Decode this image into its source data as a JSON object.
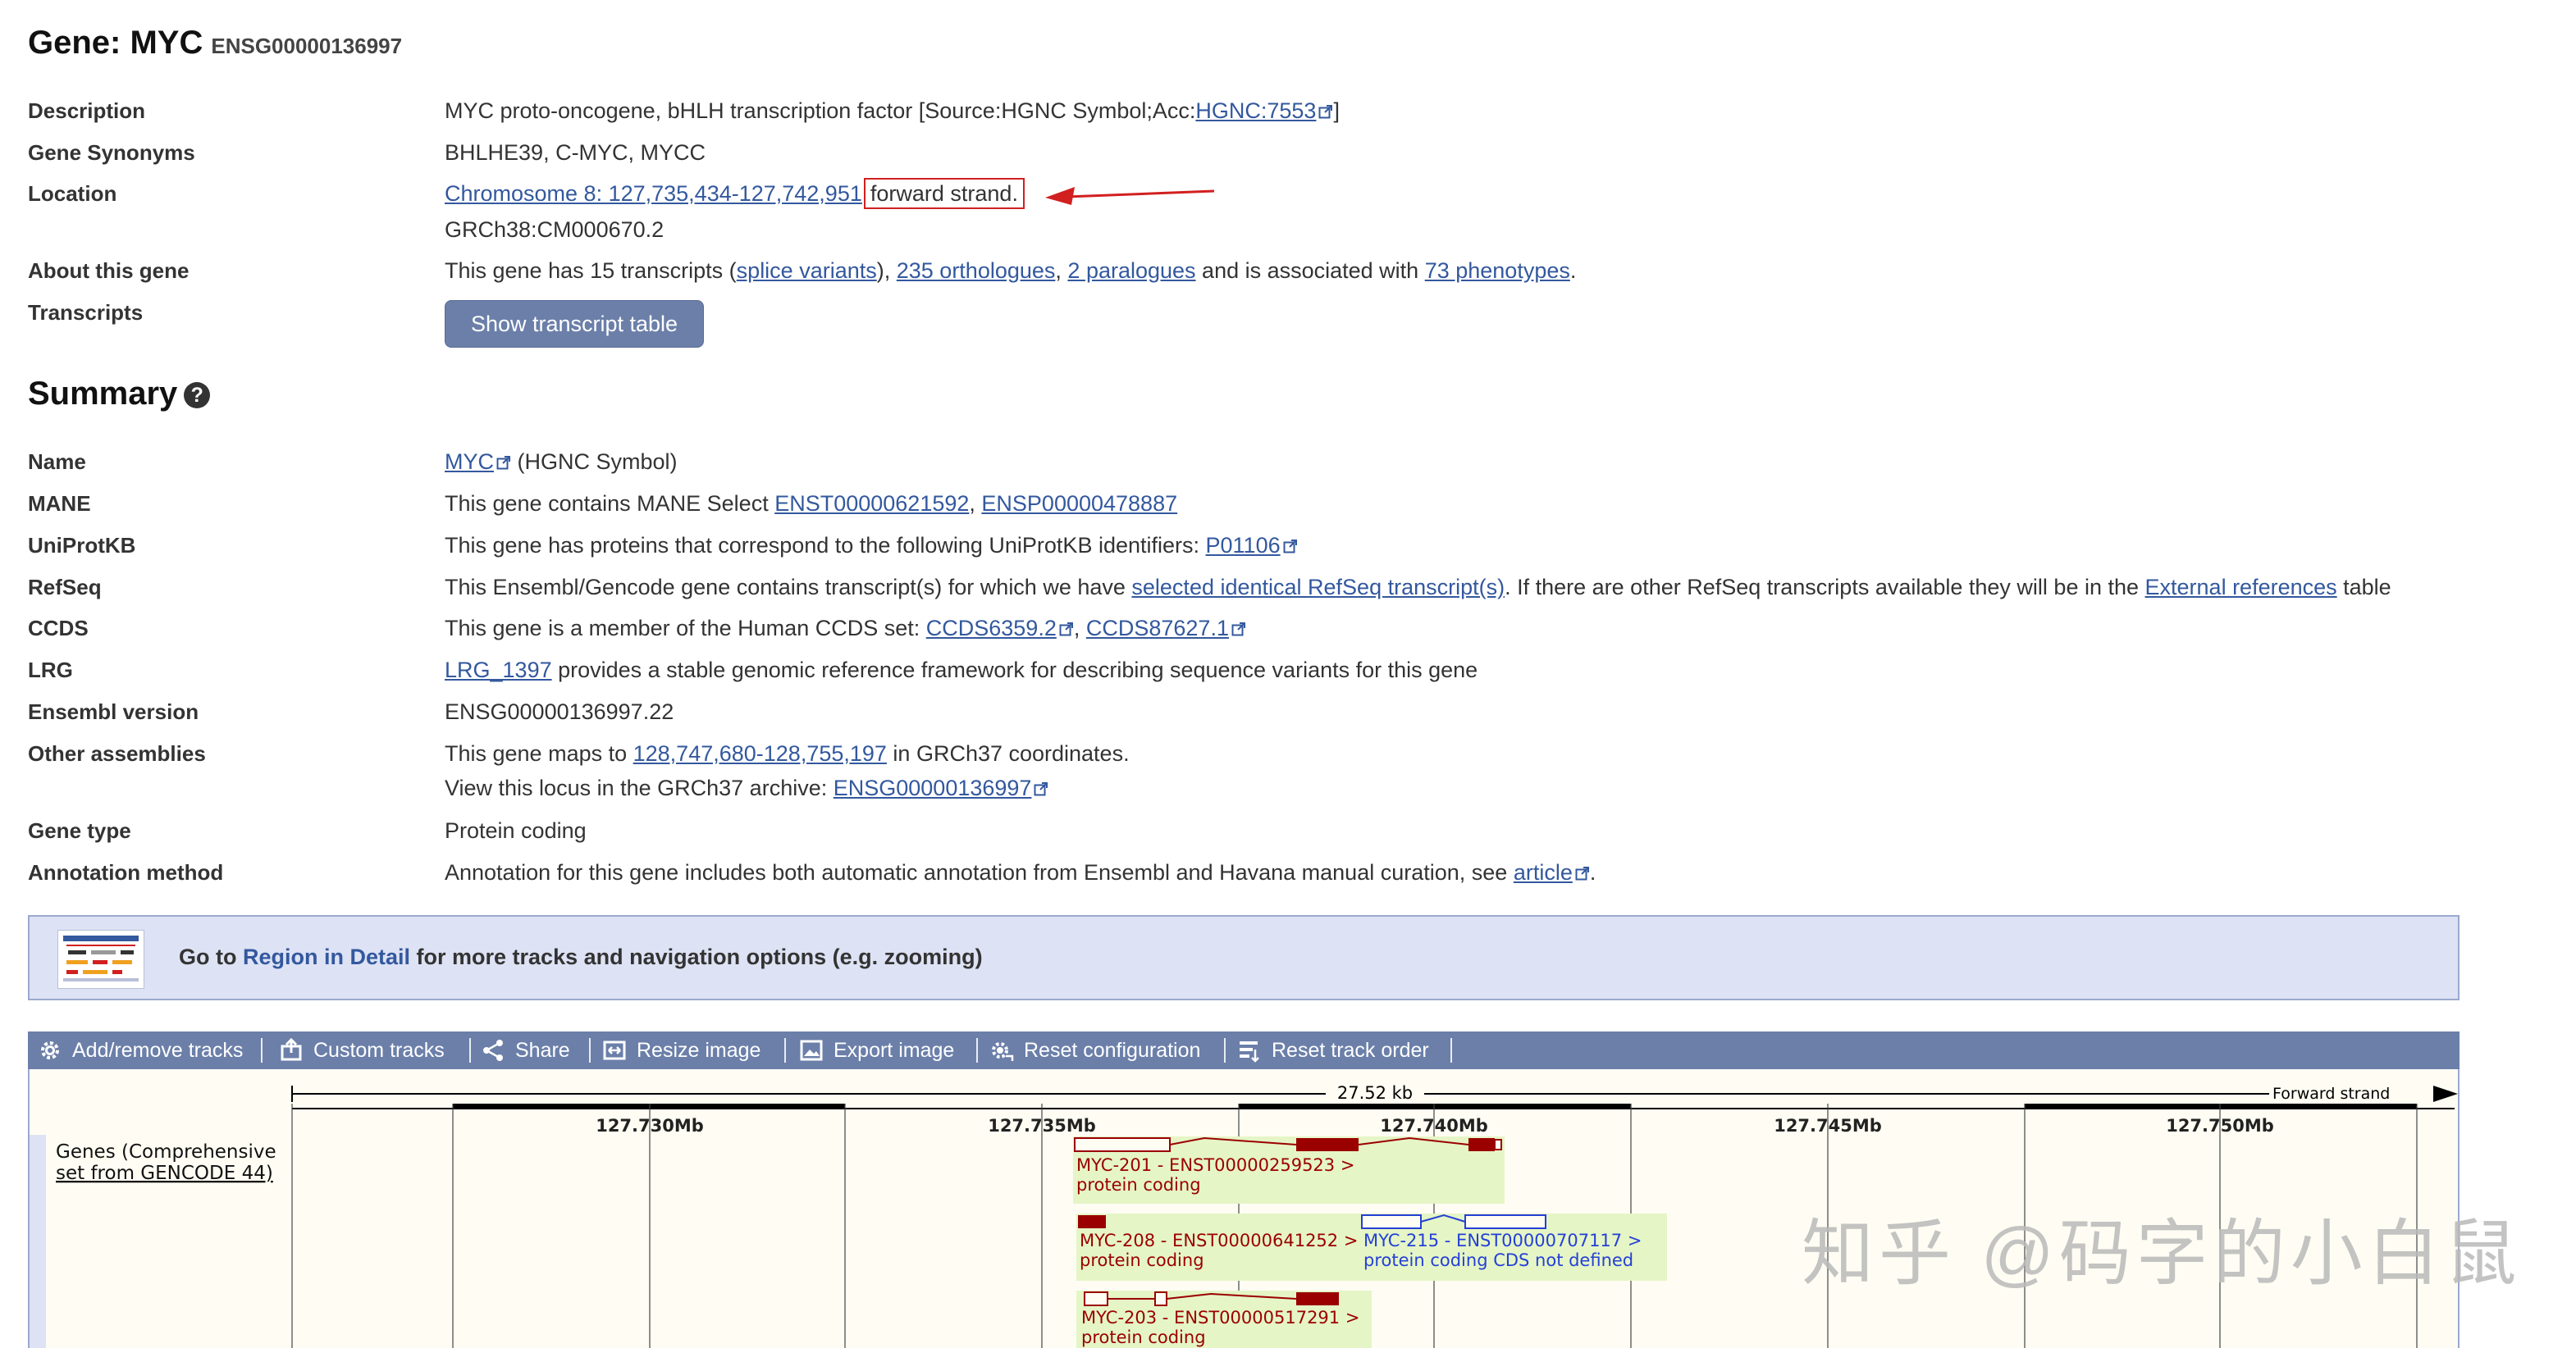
{
  "header": {
    "title": "Gene: MYC",
    "gene_id": "ENSG00000136997"
  },
  "rows": {
    "description": {
      "label": "Description",
      "text": "MYC proto-oncogene, bHLH transcription factor [Source:HGNC Symbol;Acc:",
      "link": "HGNC:7553",
      "tail": "]"
    },
    "synonyms": {
      "label": "Gene Synonyms",
      "text": "BHLHE39, C-MYC, MYCC"
    },
    "location": {
      "label": "Location",
      "link": "Chromosome 8: 127,735,434-127,742,951",
      "boxed": "forward strand.",
      "line2": "GRCh38:CM000670.2"
    },
    "about": {
      "label": "About this gene",
      "t1": "This gene has 15 transcripts (",
      "l1": "splice variants",
      "t2": "), ",
      "l2": "235 orthologues",
      "t3": ", ",
      "l3": "2 paralogues",
      "t4": " and is associated with ",
      "l4": "73 phenotypes",
      "t5": "."
    },
    "transcripts": {
      "label": "Transcripts",
      "button": "Show transcript table"
    }
  },
  "summary": {
    "title": "Summary",
    "help_icon": "?",
    "name": {
      "label": "Name",
      "link": "MYC",
      "text": " (HGNC Symbol)"
    },
    "mane": {
      "label": "MANE",
      "text": "This gene contains MANE Select ",
      "l1": "ENST00000621592",
      "sep": ", ",
      "l2": "ENSP00000478887"
    },
    "uniprot": {
      "label": "UniProtKB",
      "text": "This gene has proteins that correspond to the following UniProtKB identifiers: ",
      "link": "P01106"
    },
    "refseq": {
      "label": "RefSeq",
      "t1": "This Ensembl/Gencode gene contains transcript(s) for which we have ",
      "l1": "selected identical RefSeq transcript(s)",
      "t2": ". If there are other RefSeq transcripts available they will be in the ",
      "l2": "External references",
      "t3": " table"
    },
    "ccds": {
      "label": "CCDS",
      "text": "This gene is a member of the Human CCDS set: ",
      "l1": "CCDS6359.2",
      "sep": ", ",
      "l2": "CCDS87627.1"
    },
    "lrg": {
      "label": "LRG",
      "link": "LRG_1397",
      "text": " provides a stable genomic reference framework for describing sequence variants for this gene"
    },
    "ensembl_version": {
      "label": "Ensembl version",
      "text": "ENSG00000136997.22"
    },
    "other_assemblies": {
      "label": "Other assemblies",
      "t1": "This gene maps to ",
      "l1": "128,747,680-128,755,197",
      "t2": " in GRCh37 coordinates.",
      "t3": "View this locus in the GRCh37 archive: ",
      "l2": "ENSG00000136997"
    },
    "gene_type": {
      "label": "Gene type",
      "text": "Protein coding"
    },
    "annotation": {
      "label": "Annotation method",
      "text": "Annotation for this gene includes both automatic annotation from Ensembl and Havana manual curation, see ",
      "link": "article",
      "tail": "."
    }
  },
  "region_banner": {
    "t1": "Go to ",
    "link": "Region in Detail",
    "t2": " for more tracks and navigation options (e.g. zooming)"
  },
  "toolbar": {
    "items": [
      {
        "label": "Add/remove tracks",
        "icon": "gear-icon"
      },
      {
        "label": "Custom tracks",
        "icon": "upload-icon"
      },
      {
        "label": "Share",
        "icon": "share-icon"
      },
      {
        "label": "Resize image",
        "icon": "resize-icon"
      },
      {
        "label": "Export image",
        "icon": "image-icon"
      },
      {
        "label": "Reset configuration",
        "icon": "reset-gear-icon"
      },
      {
        "label": "Reset track order",
        "icon": "reorder-icon"
      }
    ]
  },
  "genome_view": {
    "scale_label": "27.52 kb",
    "strand_label": "Forward strand",
    "ticks": [
      "127.730Mb",
      "127.735Mb",
      "127.740Mb",
      "127.745Mb",
      "127.750Mb"
    ],
    "track_label_line1": "Genes (Comprehensive",
    "track_label_line2": "set from GENCODE 44)",
    "transcripts": [
      {
        "name": "MYC-201 - ENST00000259523 >",
        "biotype": "protein coding"
      },
      {
        "name": "MYC-208 - ENST00000641252 >",
        "biotype": "protein coding"
      },
      {
        "name": "MYC-215 - ENST00000707117 >",
        "biotype": "protein coding CDS not defined"
      },
      {
        "name": "MYC-203 - ENST00000517291 >",
        "biotype": "protein coding"
      }
    ]
  },
  "watermark": "知乎 @码字的小白鼠",
  "colors": {
    "link": "#33589e",
    "accent_toolbar": "#6b7fa9",
    "banner_bg": "#dde2f4",
    "exon_coding": "#9b0000",
    "exon_noncoding_blue": "#2440d6",
    "transcript_bg": "#e5f5c6",
    "annotation_red": "#d21f1f"
  }
}
